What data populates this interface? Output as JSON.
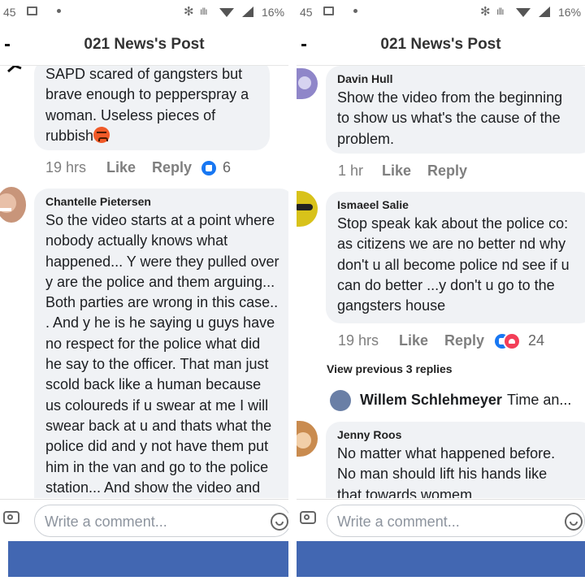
{
  "status": {
    "left_time": "45",
    "right_time": "45",
    "battery": "16%"
  },
  "left": {
    "header_title": "021 News's Post",
    "comment1": {
      "text_lines": [
        "SAPD scared of gangsters but",
        "brave enough to pepperspray a",
        "woman. Useless pieces of",
        "rubbish"
      ],
      "time": "19 hrs",
      "like": "Like",
      "reply": "Reply",
      "reaction_count": "6"
    },
    "comment2": {
      "name": "Chantelle Pietersen",
      "text_lines": [
        "So the video starts at a point where",
        "nobody actually knows what",
        "happened... Y were they pulled over",
        "y are the police and them arguing...",
        "Both parties are wrong in this case..",
        ". And y he is he saying u guys have",
        "no respect for the police what did",
        "he say to the officer. That man just",
        "scold back like a human because",
        "us coloureds if u swear at me I will",
        "swear back at u and thats what the",
        "police did and y not have them put",
        "him in the van and go to the police",
        "station... And show the video and"
      ]
    },
    "composer_placeholder": "Write a comment..."
  },
  "right": {
    "header_title": "021 News's Post",
    "comment1": {
      "name": "Davin Hull",
      "text_lines": [
        "Show the video from the beginning",
        "to show us what's the cause of the",
        "problem."
      ],
      "time": "1 hr",
      "like": "Like",
      "reply": "Reply"
    },
    "comment2": {
      "name": "Ismaeel Salie",
      "text_lines": [
        "Stop speak kak about the police co:",
        "as citizens we are no better nd why",
        "don't u all become police nd see if u",
        "can do better ...y don't u go to the",
        "gangsters house"
      ],
      "time": "19 hrs",
      "like": "Like",
      "reply": "Reply",
      "reaction_count": "24"
    },
    "view_previous": "View previous 3 replies",
    "reply_preview": {
      "name": "Willem Schlehmeyer",
      "text": "Time an..."
    },
    "comment3": {
      "name": "Jenny Roos",
      "text_lines": [
        "No matter what happened before.",
        "No man should lift his hands like",
        "that towards womem"
      ]
    },
    "composer_placeholder": "Write a comment..."
  },
  "colors": {
    "bubble": "#f0f2f5",
    "facebook_blue": "#4267b2",
    "like_blue": "#1877f2",
    "love_red": "#f33e58"
  }
}
